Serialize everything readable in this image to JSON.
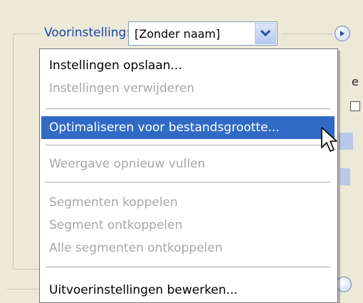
{
  "preset": {
    "label": "Voorinstelling:",
    "value": "[Zonder naam]"
  },
  "side": {
    "letter": "e"
  },
  "menu": {
    "items": [
      {
        "label": "Instellingen opslaan...",
        "enabled": true
      },
      {
        "label": "Instellingen verwijderen",
        "enabled": false
      },
      {
        "label": "Optimaliseren voor bestandsgrootte...",
        "enabled": true,
        "highlighted": true
      },
      {
        "label": "Weergave opnieuw vullen",
        "enabled": false
      },
      {
        "label": "Segmenten koppelen",
        "enabled": false
      },
      {
        "label": "Segment ontkoppelen",
        "enabled": false
      },
      {
        "label": "Alle segmenten ontkoppelen",
        "enabled": false
      },
      {
        "label": "Uitvoerinstellingen bewerken...",
        "enabled": true
      }
    ]
  },
  "colors": {
    "highlight": "#316ac5",
    "label_blue": "#1a43a8",
    "disabled": "#a7a6aa"
  }
}
